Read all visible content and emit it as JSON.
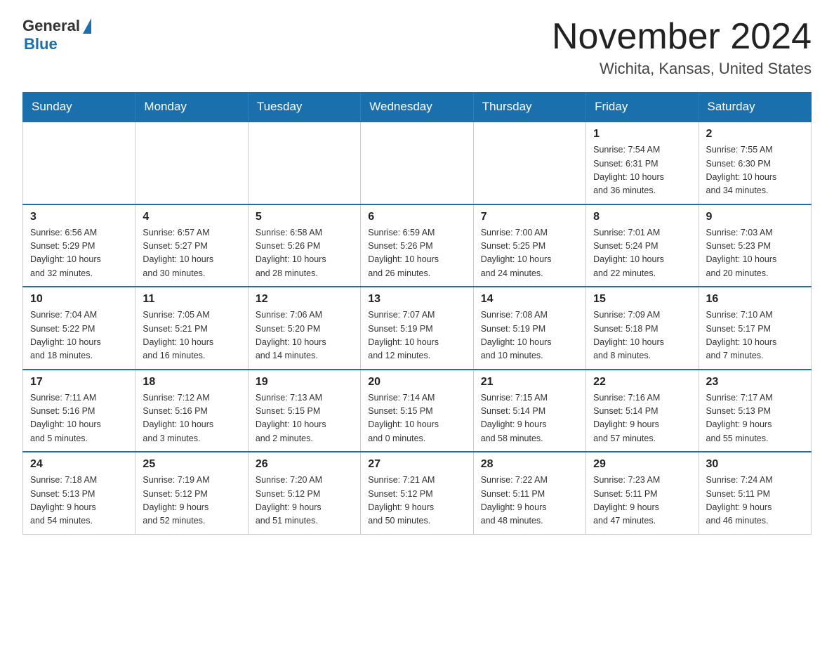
{
  "header": {
    "logo": {
      "general": "General",
      "blue": "Blue"
    },
    "title": "November 2024",
    "subtitle": "Wichita, Kansas, United States"
  },
  "weekdays": [
    "Sunday",
    "Monday",
    "Tuesday",
    "Wednesday",
    "Thursday",
    "Friday",
    "Saturday"
  ],
  "weeks": [
    [
      {
        "day": "",
        "info": ""
      },
      {
        "day": "",
        "info": ""
      },
      {
        "day": "",
        "info": ""
      },
      {
        "day": "",
        "info": ""
      },
      {
        "day": "",
        "info": ""
      },
      {
        "day": "1",
        "info": "Sunrise: 7:54 AM\nSunset: 6:31 PM\nDaylight: 10 hours\nand 36 minutes."
      },
      {
        "day": "2",
        "info": "Sunrise: 7:55 AM\nSunset: 6:30 PM\nDaylight: 10 hours\nand 34 minutes."
      }
    ],
    [
      {
        "day": "3",
        "info": "Sunrise: 6:56 AM\nSunset: 5:29 PM\nDaylight: 10 hours\nand 32 minutes."
      },
      {
        "day": "4",
        "info": "Sunrise: 6:57 AM\nSunset: 5:27 PM\nDaylight: 10 hours\nand 30 minutes."
      },
      {
        "day": "5",
        "info": "Sunrise: 6:58 AM\nSunset: 5:26 PM\nDaylight: 10 hours\nand 28 minutes."
      },
      {
        "day": "6",
        "info": "Sunrise: 6:59 AM\nSunset: 5:26 PM\nDaylight: 10 hours\nand 26 minutes."
      },
      {
        "day": "7",
        "info": "Sunrise: 7:00 AM\nSunset: 5:25 PM\nDaylight: 10 hours\nand 24 minutes."
      },
      {
        "day": "8",
        "info": "Sunrise: 7:01 AM\nSunset: 5:24 PM\nDaylight: 10 hours\nand 22 minutes."
      },
      {
        "day": "9",
        "info": "Sunrise: 7:03 AM\nSunset: 5:23 PM\nDaylight: 10 hours\nand 20 minutes."
      }
    ],
    [
      {
        "day": "10",
        "info": "Sunrise: 7:04 AM\nSunset: 5:22 PM\nDaylight: 10 hours\nand 18 minutes."
      },
      {
        "day": "11",
        "info": "Sunrise: 7:05 AM\nSunset: 5:21 PM\nDaylight: 10 hours\nand 16 minutes."
      },
      {
        "day": "12",
        "info": "Sunrise: 7:06 AM\nSunset: 5:20 PM\nDaylight: 10 hours\nand 14 minutes."
      },
      {
        "day": "13",
        "info": "Sunrise: 7:07 AM\nSunset: 5:19 PM\nDaylight: 10 hours\nand 12 minutes."
      },
      {
        "day": "14",
        "info": "Sunrise: 7:08 AM\nSunset: 5:19 PM\nDaylight: 10 hours\nand 10 minutes."
      },
      {
        "day": "15",
        "info": "Sunrise: 7:09 AM\nSunset: 5:18 PM\nDaylight: 10 hours\nand 8 minutes."
      },
      {
        "day": "16",
        "info": "Sunrise: 7:10 AM\nSunset: 5:17 PM\nDaylight: 10 hours\nand 7 minutes."
      }
    ],
    [
      {
        "day": "17",
        "info": "Sunrise: 7:11 AM\nSunset: 5:16 PM\nDaylight: 10 hours\nand 5 minutes."
      },
      {
        "day": "18",
        "info": "Sunrise: 7:12 AM\nSunset: 5:16 PM\nDaylight: 10 hours\nand 3 minutes."
      },
      {
        "day": "19",
        "info": "Sunrise: 7:13 AM\nSunset: 5:15 PM\nDaylight: 10 hours\nand 2 minutes."
      },
      {
        "day": "20",
        "info": "Sunrise: 7:14 AM\nSunset: 5:15 PM\nDaylight: 10 hours\nand 0 minutes."
      },
      {
        "day": "21",
        "info": "Sunrise: 7:15 AM\nSunset: 5:14 PM\nDaylight: 9 hours\nand 58 minutes."
      },
      {
        "day": "22",
        "info": "Sunrise: 7:16 AM\nSunset: 5:14 PM\nDaylight: 9 hours\nand 57 minutes."
      },
      {
        "day": "23",
        "info": "Sunrise: 7:17 AM\nSunset: 5:13 PM\nDaylight: 9 hours\nand 55 minutes."
      }
    ],
    [
      {
        "day": "24",
        "info": "Sunrise: 7:18 AM\nSunset: 5:13 PM\nDaylight: 9 hours\nand 54 minutes."
      },
      {
        "day": "25",
        "info": "Sunrise: 7:19 AM\nSunset: 5:12 PM\nDaylight: 9 hours\nand 52 minutes."
      },
      {
        "day": "26",
        "info": "Sunrise: 7:20 AM\nSunset: 5:12 PM\nDaylight: 9 hours\nand 51 minutes."
      },
      {
        "day": "27",
        "info": "Sunrise: 7:21 AM\nSunset: 5:12 PM\nDaylight: 9 hours\nand 50 minutes."
      },
      {
        "day": "28",
        "info": "Sunrise: 7:22 AM\nSunset: 5:11 PM\nDaylight: 9 hours\nand 48 minutes."
      },
      {
        "day": "29",
        "info": "Sunrise: 7:23 AM\nSunset: 5:11 PM\nDaylight: 9 hours\nand 47 minutes."
      },
      {
        "day": "30",
        "info": "Sunrise: 7:24 AM\nSunset: 5:11 PM\nDaylight: 9 hours\nand 46 minutes."
      }
    ]
  ]
}
